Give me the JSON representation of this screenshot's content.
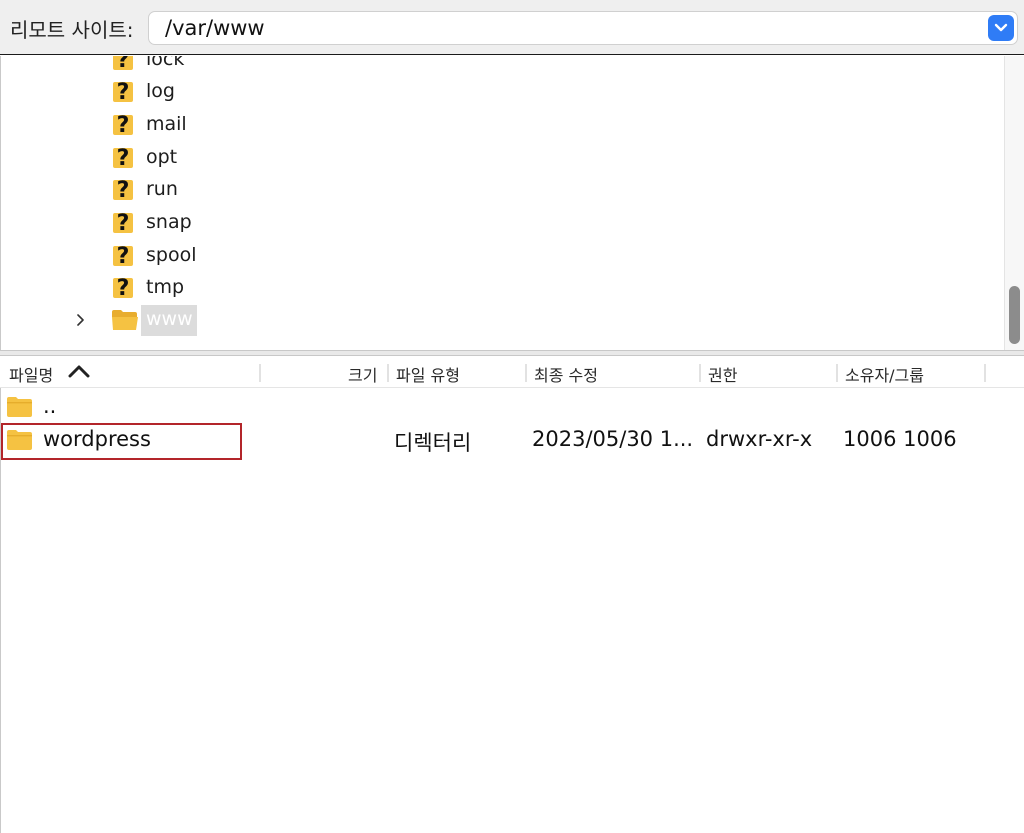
{
  "topbar": {
    "label": "리모트 사이트:",
    "path": "/var/www"
  },
  "tree": {
    "partial_item": "lock",
    "items": [
      "log",
      "mail",
      "opt",
      "run",
      "snap",
      "spool",
      "tmp"
    ],
    "selected_item": "www"
  },
  "list": {
    "columns": {
      "name": "파일명",
      "size": "크기",
      "type": "파일 유형",
      "modified": "최종 수정",
      "perms": "권한",
      "owner": "소유자/그룹"
    },
    "rows": [
      {
        "name": "..",
        "size": "",
        "type": "",
        "modified": "",
        "perms": "",
        "owner": ""
      },
      {
        "name": "wordpress",
        "size": "",
        "type": "디렉터리",
        "modified": "2023/05/30 1...",
        "perms": "drwxr-xr-x",
        "owner": "1006 1006"
      }
    ]
  },
  "colors": {
    "accent": "#2f7cf6",
    "folder": "#f5c242",
    "highlight": "#b3252a"
  }
}
